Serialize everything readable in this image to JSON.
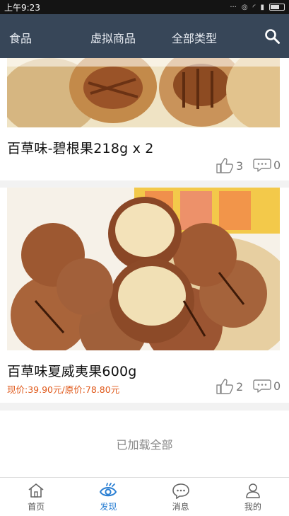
{
  "status_bar": {
    "time": "上午9:23"
  },
  "top_nav": {
    "items": [
      "食品",
      "虚拟商品",
      "全部类型"
    ]
  },
  "feed": [
    {
      "title": "百草味-碧根果218g x 2",
      "price": "",
      "likes": "3",
      "comments": "0"
    },
    {
      "title": "百草味夏威夷果600g",
      "price": "现价:39.90元/原价:78.80元",
      "likes": "2",
      "comments": "0"
    }
  ],
  "footer_text": "已加载全部",
  "bottom_tabs": [
    {
      "label": "首页",
      "icon": "home-icon"
    },
    {
      "label": "发现",
      "icon": "eye-icon",
      "active": true
    },
    {
      "label": "消息",
      "icon": "message-icon"
    },
    {
      "label": "我的",
      "icon": "user-icon"
    }
  ],
  "colors": {
    "nav_bg": "#374658",
    "accent": "#2a7fd3",
    "price": "#e05a1c"
  }
}
